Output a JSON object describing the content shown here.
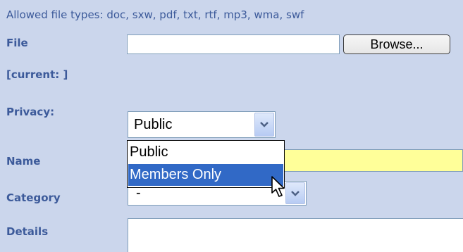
{
  "form": {
    "allowed_types": "Allowed file types: doc, sxw, pdf, txt, rtf, mp3, wma, swf",
    "file_label": "File",
    "file_value": "",
    "browse_label": "Browse...",
    "current_label": "[current: ]",
    "privacy_label": "Privacy:",
    "privacy_selected": "Public",
    "privacy_options": [
      "Public",
      "Members Only"
    ],
    "privacy_highlighted": "Members Only",
    "name_label": "Name",
    "name_value": "",
    "category_label": "Category",
    "category_selected": "-",
    "details_label": "Details",
    "details_value": ""
  },
  "colors": {
    "panel_bg": "#cbd6ec",
    "label_text": "#3c5a9a",
    "name_field_bg": "#ffff99",
    "highlight": "#3169c6"
  },
  "icons": {
    "select_arrow": "chevron-down-icon",
    "pointer": "mouse-cursor-icon"
  }
}
